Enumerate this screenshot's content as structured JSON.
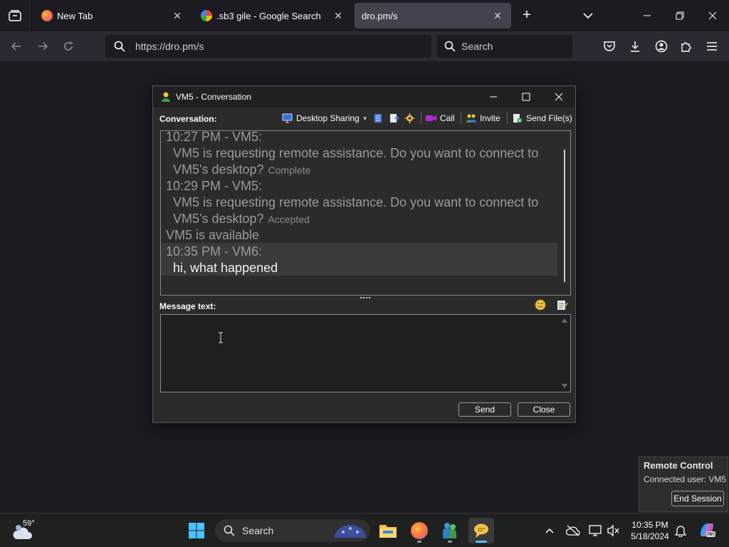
{
  "browser": {
    "tabs": [
      {
        "title": "New Tab",
        "active": false
      },
      {
        "title": ".sb3 gile - Google Search",
        "active": false
      },
      {
        "title": "dro.pm/s",
        "active": true
      }
    ],
    "url": "https://dro.pm/s",
    "search_placeholder": "Search"
  },
  "conversation_window": {
    "title": "VM5 - Conversation",
    "conversation_label": "Conversation:",
    "toolbar": {
      "desktop_sharing": "Desktop Sharing",
      "call": "Call",
      "invite": "Invite",
      "send_files": "Send File(s)"
    },
    "history": [
      {
        "header": "10:27 PM - VM5:",
        "line1": "VM5 is requesting remote assistance. Do you want to connect to",
        "line2": "VM5's desktop?",
        "status": "Complete"
      },
      {
        "header": "10:29 PM - VM5:",
        "line1": "VM5 is requesting remote assistance. Do you want to connect to",
        "line2": "VM5's desktop?",
        "status": "Accepted"
      }
    ],
    "availability": "VM5 is available",
    "last_message": {
      "header": "10:35 PM - VM6:",
      "text": "hi, what happened"
    },
    "message_label": "Message text:",
    "message_value": "",
    "send_label": "Send",
    "close_label": "Close"
  },
  "remote_control": {
    "title": "Remote Control",
    "connected_user": "Connected user: VM5",
    "end_session": "End Session"
  },
  "taskbar": {
    "temperature": "59°",
    "search_label": "Search",
    "time": "10:35 PM",
    "date": "5/18/2024"
  },
  "colors": {
    "accent": "#4cc2ff",
    "window_bg": "#2b2b2b",
    "page_bg": "#1c1b22"
  }
}
